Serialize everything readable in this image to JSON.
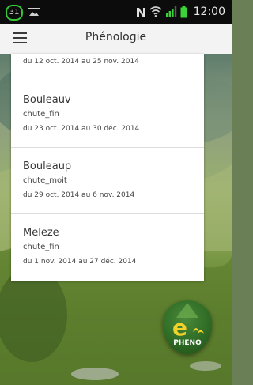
{
  "status_bar": {
    "notification_badge": "31",
    "time": "12:00"
  },
  "app_bar": {
    "title": "Phénologie"
  },
  "observations": [
    {
      "dates": "du 12 oct. 2014 au 25 nov. 2014"
    },
    {
      "name": "Bouleauv",
      "stage": "chute_fin",
      "dates": "du 23 oct. 2014 au 30 déc. 2014"
    },
    {
      "name": "Bouleaup",
      "stage": "chute_moit",
      "dates": "du 29 oct. 2014 au 6 nov. 2014"
    },
    {
      "name": "Meleze",
      "stage": "chute_fin",
      "dates": "du 1 nov. 2014 au 27 déc. 2014"
    }
  ],
  "logo": {
    "text": "PHENO"
  },
  "colors": {
    "status_bar_bg": "#0c0c0c",
    "app_bar_bg": "#f3f3f3",
    "logo_green": "#2f6b25",
    "logo_yellow": "#f2d12a",
    "battery_green": "#3ad43a"
  }
}
